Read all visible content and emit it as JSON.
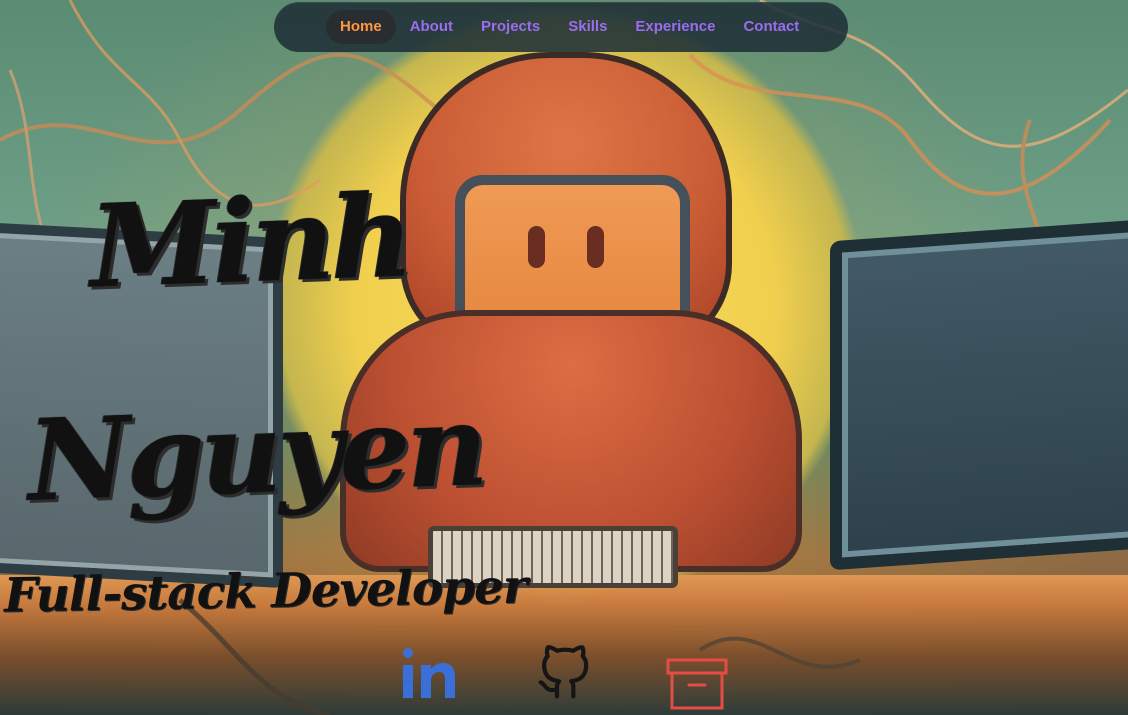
{
  "nav": {
    "items": [
      {
        "label": "Home",
        "active": true
      },
      {
        "label": "About",
        "active": false
      },
      {
        "label": "Projects",
        "active": false
      },
      {
        "label": "Skills",
        "active": false
      },
      {
        "label": "Experience",
        "active": false
      },
      {
        "label": "Contact",
        "active": false
      }
    ],
    "colors": {
      "active": "#ff9840",
      "inactive": "#9b6cf0",
      "background": "#1f3037"
    }
  },
  "hero": {
    "first_name": "Minh",
    "last_name": "Nguyen",
    "role": "Full-stack Developer"
  },
  "social": {
    "items": [
      {
        "name": "linkedin",
        "icon": "linkedin-icon",
        "color": "#3b6fd8"
      },
      {
        "name": "github",
        "icon": "github-icon",
        "color": "#151515"
      },
      {
        "name": "archive",
        "icon": "archive-box-icon",
        "color": "#e34d45"
      }
    ]
  }
}
